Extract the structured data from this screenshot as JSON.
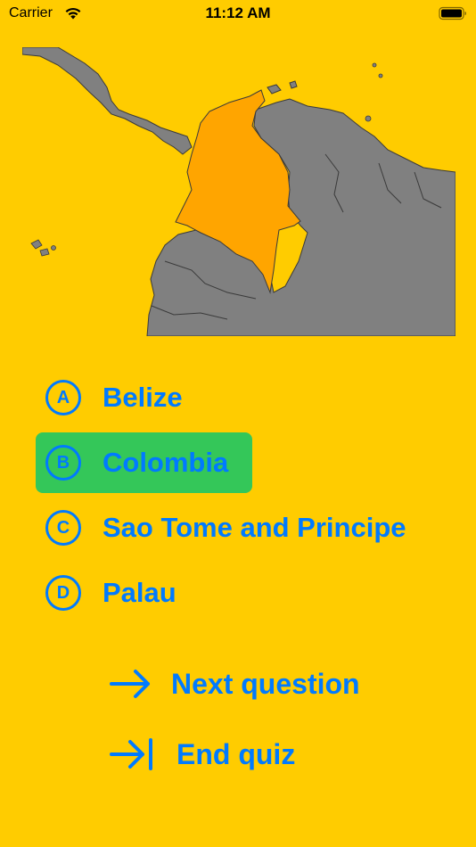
{
  "status_bar": {
    "carrier": "Carrier",
    "time": "11:12 AM"
  },
  "map": {
    "highlighted_country_color": "#FFA500",
    "other_land_color": "#808080",
    "water_color": "#FFCC00"
  },
  "answers": [
    {
      "letter": "A",
      "label": "Belize",
      "selected": false
    },
    {
      "letter": "B",
      "label": "Colombia",
      "selected": true
    },
    {
      "letter": "C",
      "label": "Sao Tome and Principe",
      "selected": false
    },
    {
      "letter": "D",
      "label": "Palau",
      "selected": false
    }
  ],
  "actions": {
    "next_label": "Next question",
    "end_label": "End quiz"
  },
  "colors": {
    "background": "#FFCC00",
    "accent": "#007AFF",
    "selected": "#34C759"
  }
}
